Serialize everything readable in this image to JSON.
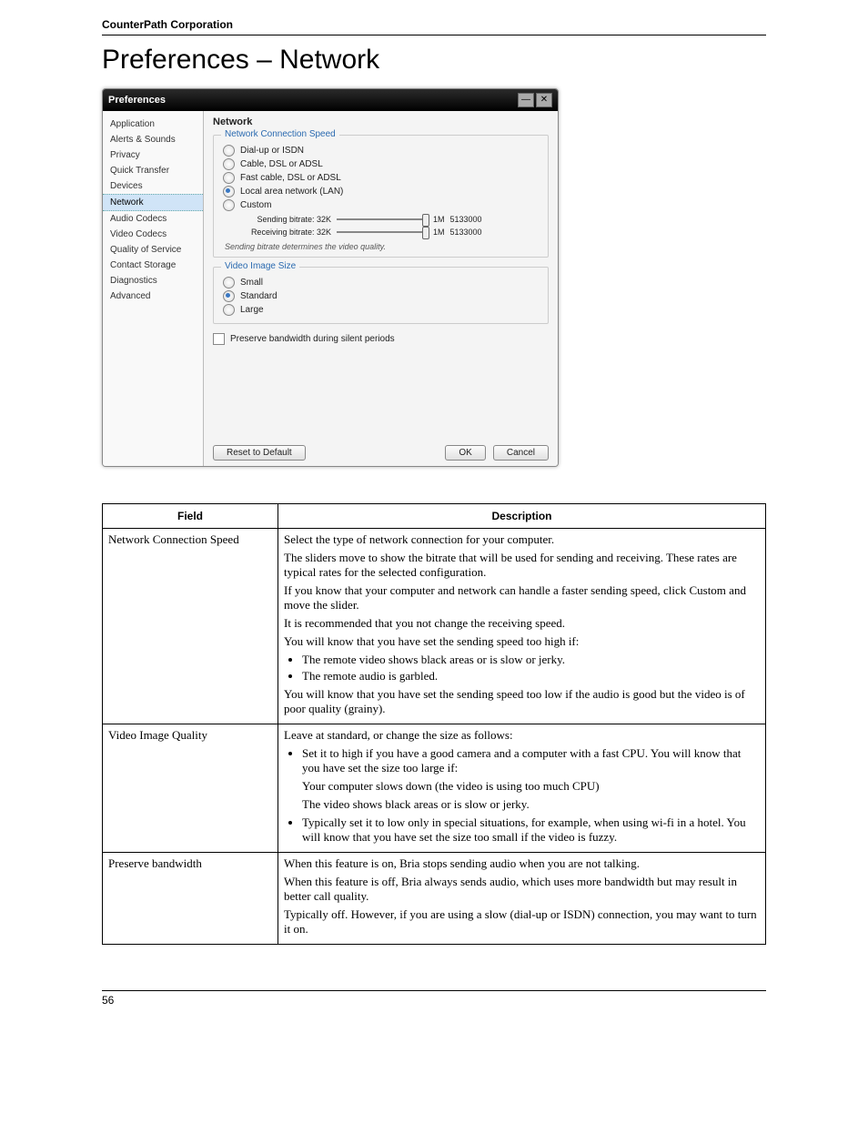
{
  "header": "CounterPath Corporation",
  "page_title": "Preferences – Network",
  "page_number": "56",
  "dialog": {
    "title": "Preferences",
    "sidebar": [
      "Application",
      "Alerts & Sounds",
      "Privacy",
      "Quick Transfer",
      "Devices",
      "Network",
      "Audio Codecs",
      "Video Codecs",
      "Quality of Service",
      "Contact Storage",
      "Diagnostics",
      "Advanced"
    ],
    "sidebar_selected": "Network",
    "panel_title": "Network",
    "groups": {
      "speed": {
        "legend": "Network Connection Speed",
        "opts": [
          "Dial-up or ISDN",
          "Cable, DSL or ADSL",
          "Fast cable, DSL or ADSL",
          "Local area network (LAN)",
          "Custom"
        ],
        "selected": "Local area network (LAN)",
        "sliders": [
          {
            "label": "Sending bitrate:",
            "lo": "32K",
            "hi": "1M",
            "val": "5133000"
          },
          {
            "label": "Receiving bitrate:",
            "lo": "32K",
            "hi": "1M",
            "val": "5133000"
          }
        ],
        "note": "Sending bitrate determines the video quality."
      },
      "size": {
        "legend": "Video Image Size",
        "opts": [
          "Small",
          "Standard",
          "Large"
        ],
        "selected": "Standard"
      },
      "preserve": "Preserve bandwidth during silent periods"
    },
    "buttons": {
      "reset": "Reset to Default",
      "ok": "OK",
      "cancel": "Cancel"
    }
  },
  "table": {
    "head": [
      "Field",
      "Description"
    ],
    "rows": [
      {
        "field": "Network Connection Speed",
        "desc": [
          {
            "p": "Select the type of network connection for your computer."
          },
          {
            "p": "The sliders move to show the bitrate that will be used for sending and receiving. These rates are typical rates for the selected configuration."
          },
          {
            "p": "If you know that your computer and network can handle a faster sending speed, click Custom and move the slider."
          },
          {
            "p": "It is recommended that you not change the receiving speed."
          },
          {
            "p": "You will know that you have set the sending speed too high if:"
          },
          {
            "ul": [
              "The remote video shows black areas or is slow or jerky.",
              "The remote audio is garbled."
            ]
          },
          {
            "p": "You will know that you have set the sending speed too low if the audio is good but the video is of poor quality (grainy)."
          }
        ]
      },
      {
        "field": "Video Image Quality",
        "desc": [
          {
            "p": "Leave at standard, or change the size as follows:"
          },
          {
            "ul": [
              "Set it to high if you have a good camera and a computer with a fast CPU. You will know that you have set the size too large if:",
              "Your computer slows down (the video is using too much CPU)",
              "The video shows black areas or is slow or jerky.",
              "Typically set it to low only in special situations, for example, when using wi-fi in a hotel. You will know that you have set the size too small if the video is fuzzy."
            ],
            "indent": [
              0,
              1,
              1,
              0
            ]
          }
        ]
      },
      {
        "field": "Preserve bandwidth",
        "desc": [
          {
            "p": "When this feature is on, Bria stops sending audio when you are not talking."
          },
          {
            "p": "When this feature is off, Bria always sends audio, which uses more bandwidth but may result in better call quality."
          },
          {
            "p": "Typically off. However, if you are using a slow (dial-up or ISDN) connection, you may want to turn it on."
          }
        ]
      }
    ]
  }
}
